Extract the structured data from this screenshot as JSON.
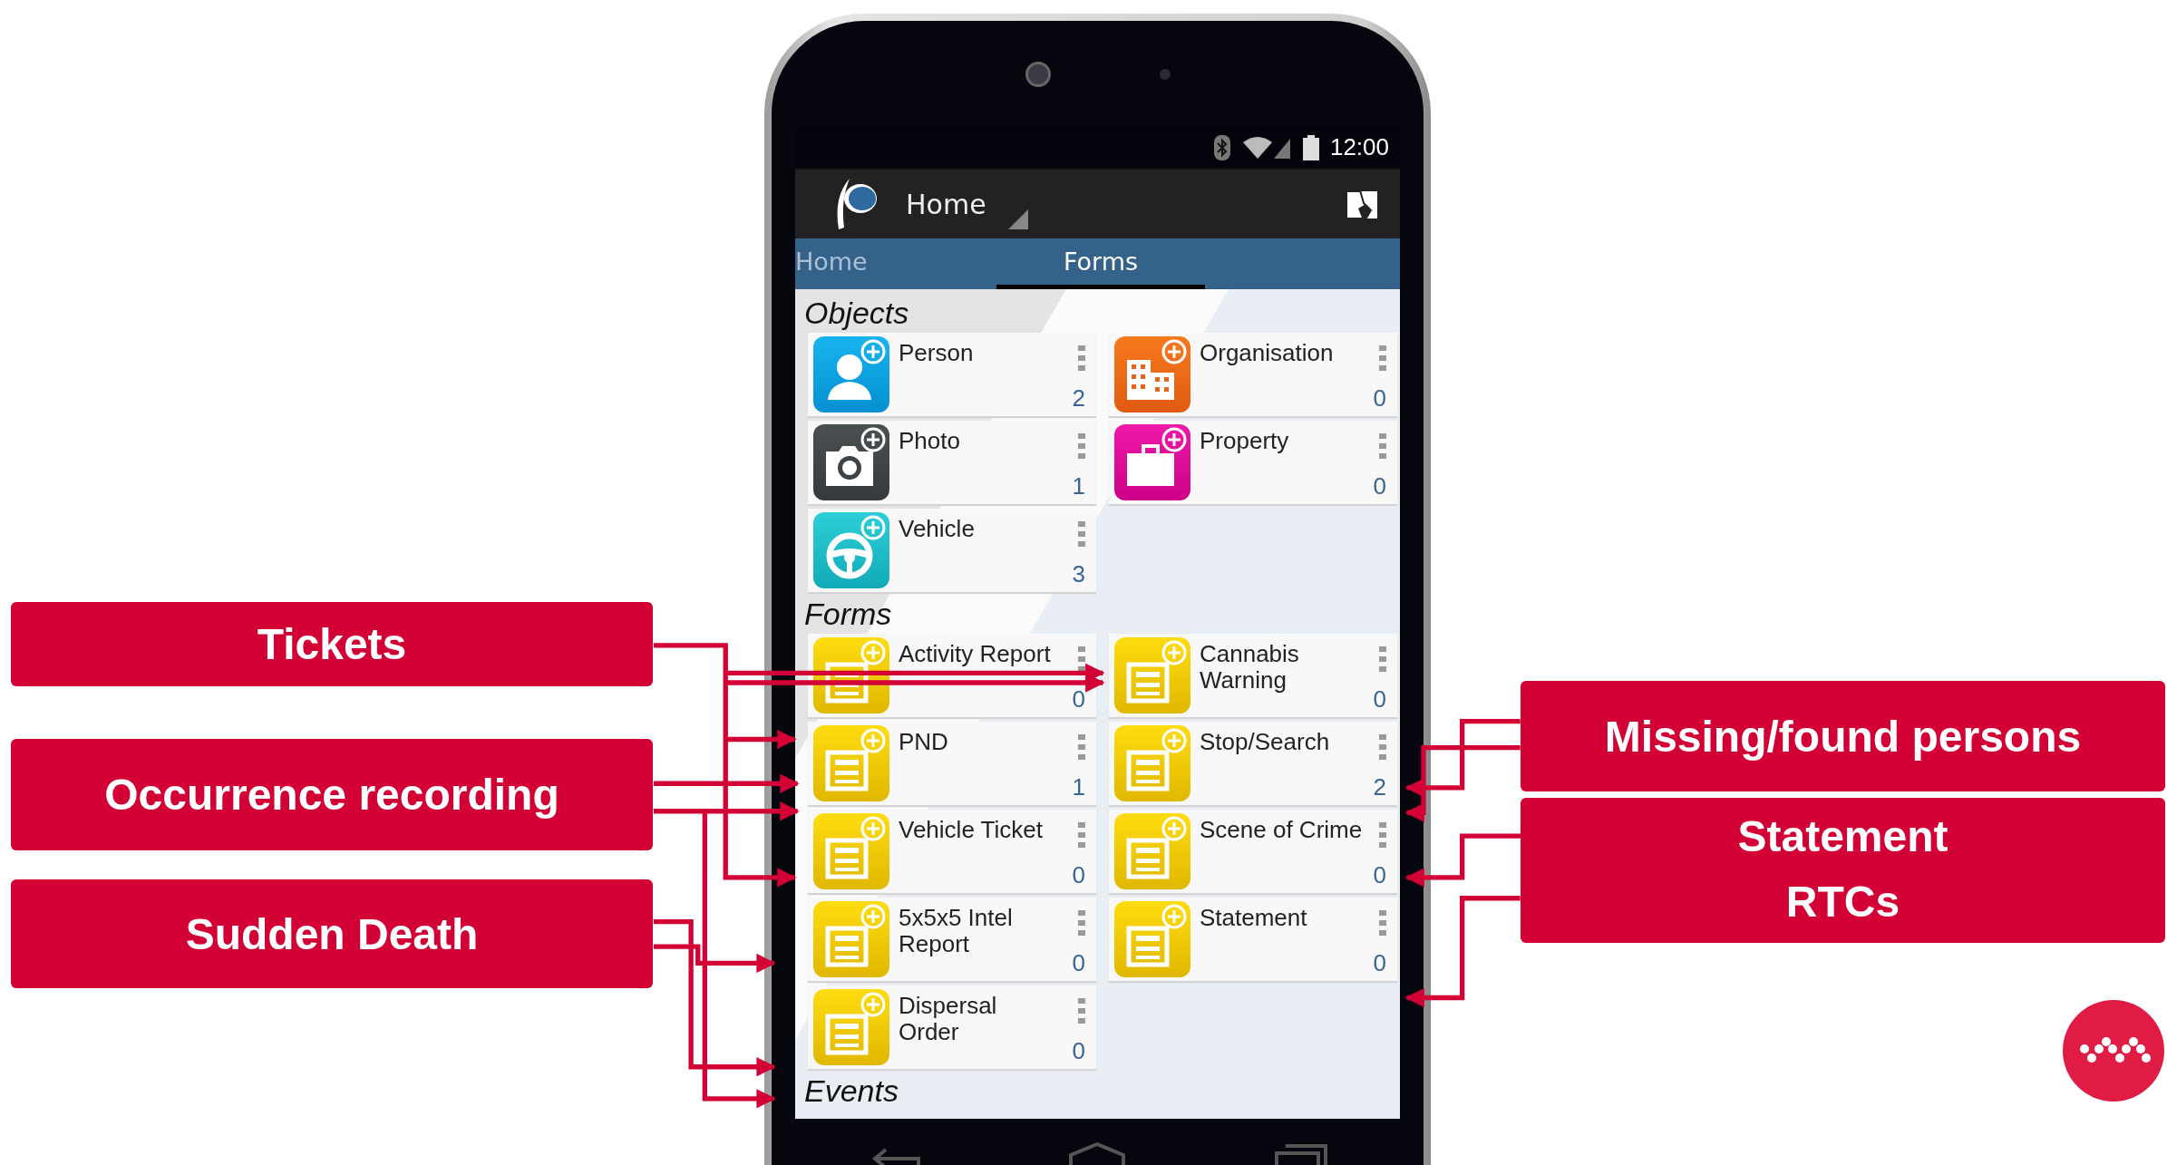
{
  "status_bar": {
    "time": "12:00"
  },
  "action_bar": {
    "title": "Home"
  },
  "tabs": [
    {
      "label": "Home",
      "selected": false
    },
    {
      "label": "Forms",
      "selected": true
    }
  ],
  "sections": [
    {
      "title": "Objects",
      "items": [
        {
          "name": "Person",
          "count": "2",
          "kind": "person"
        },
        {
          "name": "Organisation",
          "count": "0",
          "kind": "organisation"
        },
        {
          "name": "Photo",
          "count": "1",
          "kind": "photo"
        },
        {
          "name": "Property",
          "count": "0",
          "kind": "property"
        },
        {
          "name": "Vehicle",
          "count": "3",
          "kind": "vehicle"
        }
      ]
    },
    {
      "title": "Forms",
      "items": [
        {
          "name": "Activity Report",
          "count": "0",
          "kind": "form"
        },
        {
          "name": "Cannabis Warning",
          "count": "0",
          "kind": "form"
        },
        {
          "name": "PND",
          "count": "1",
          "kind": "form"
        },
        {
          "name": "Stop/Search",
          "count": "2",
          "kind": "form"
        },
        {
          "name": "Vehicle Ticket",
          "count": "0",
          "kind": "form"
        },
        {
          "name": "Scene of Crime",
          "count": "0",
          "kind": "form"
        },
        {
          "name": "5x5x5 Intel Report",
          "count": "0",
          "kind": "form"
        },
        {
          "name": "Statement",
          "count": "0",
          "kind": "form"
        },
        {
          "name": "Dispersal Order",
          "count": "0",
          "kind": "form"
        }
      ]
    },
    {
      "title": "Events"
    }
  ],
  "callouts_left": [
    {
      "label": "Tickets"
    },
    {
      "label": "Occurrence recording"
    },
    {
      "label": "Sudden Death"
    }
  ],
  "callouts_right": [
    {
      "label": "Missing/found persons"
    },
    {
      "label": "Statement"
    },
    {
      "label": "RTCs"
    }
  ]
}
